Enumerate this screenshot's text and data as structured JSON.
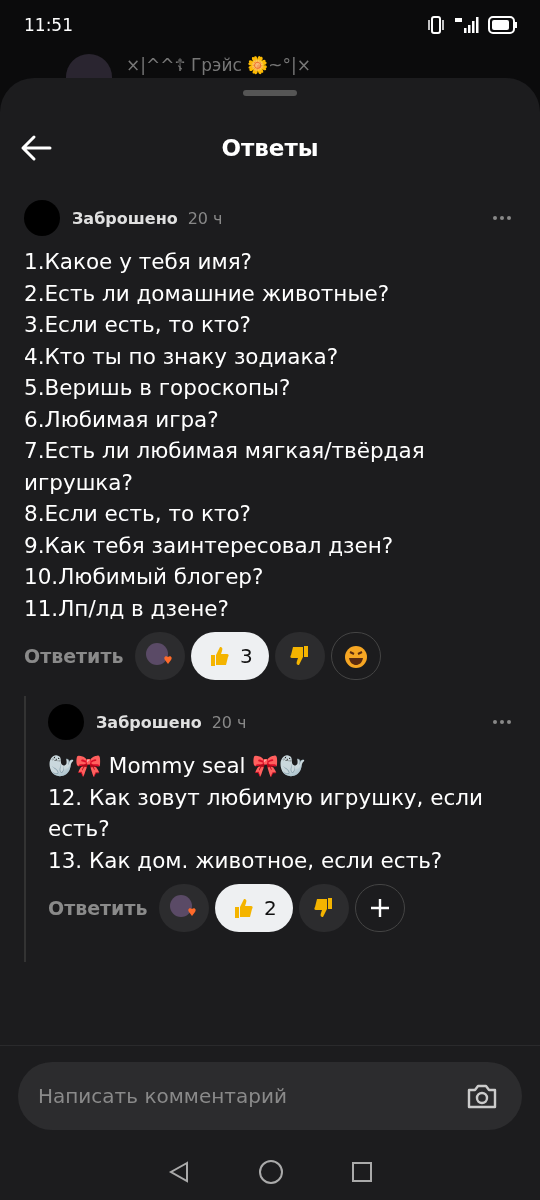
{
  "status_bar": {
    "time": "11:51"
  },
  "background_header": {
    "title": "×|^^☦ Грэйс 🌼~°|×"
  },
  "sheet": {
    "title": "Ответы"
  },
  "comment": {
    "author": "Заброшено",
    "time": "20 ч",
    "lines": [
      "1.Какое у тебя имя?",
      "2.Есть ли домашние животные?",
      "3.Если есть, то кто?",
      "4.Кто ты по знаку зодиака?",
      "5.Веришь в гороскопы?",
      "6.Любимая игра?",
      "7.Есть ли любимая мягкая/твёрдая игрушка?",
      "8.Если есть, то кто?",
      "9.Как тебя заинтересовал дзен?",
      "10.Любимый блогер?",
      "11.Лп/лд в дзене?"
    ],
    "reply_label": "Ответить",
    "reactions": [
      {
        "kind": "avatar-heart"
      },
      {
        "kind": "like",
        "count": "3",
        "selected": true
      },
      {
        "kind": "dislike",
        "selected": false
      },
      {
        "kind": "laugh"
      }
    ],
    "replies": [
      {
        "author": "Заброшено",
        "time": "20 ч",
        "lines": [
          "🦭🎀 Mommy seal 🎀🦭",
          "12. Как зовут любимую игрушку, если есть?",
          "13. Как дом. животное, если есть?"
        ],
        "reply_label": "Ответить",
        "reactions": [
          {
            "kind": "avatar-heart"
          },
          {
            "kind": "like",
            "count": "2",
            "selected": true
          },
          {
            "kind": "dislike",
            "selected": false
          },
          {
            "kind": "add"
          }
        ]
      }
    ]
  },
  "composer": {
    "placeholder": "Написать комментарий"
  }
}
